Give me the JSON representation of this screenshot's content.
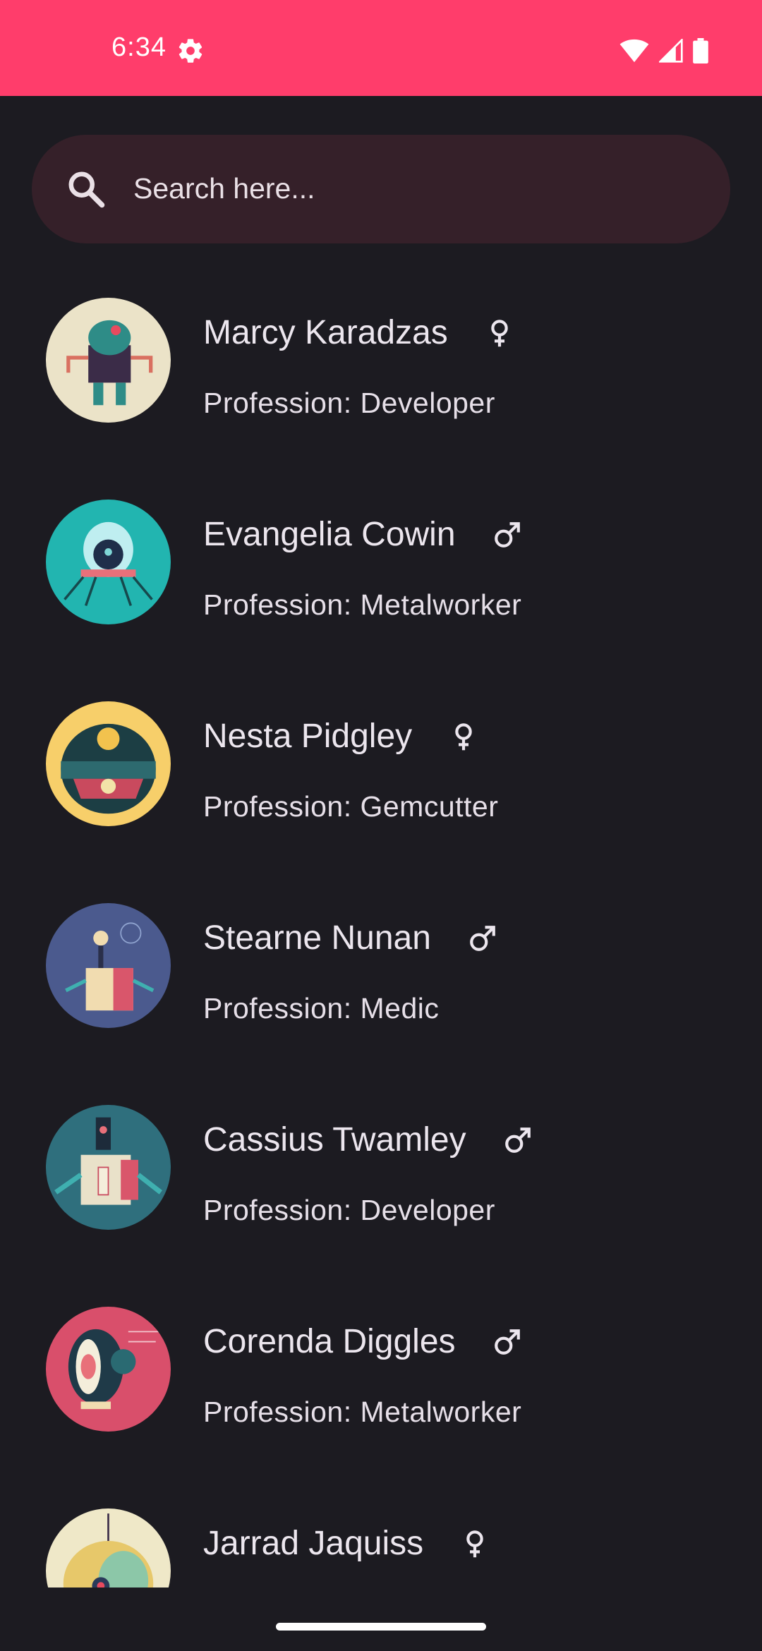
{
  "status_bar": {
    "time": "6:34",
    "background_color": "#ff3d6b",
    "icons": [
      "settings-gear-icon",
      "wifi-icon",
      "cellular-signal-icon",
      "battery-icon"
    ]
  },
  "search": {
    "placeholder": "Search here...",
    "icon": "search-icon"
  },
  "characters": [
    {
      "name": "Marcy Karadzas",
      "gender": "female",
      "profession": "Profession: Developer",
      "avatar_color": "#ebe3c8"
    },
    {
      "name": "Evangelia Cowin",
      "gender": "male",
      "profession": "Profession: Metalworker",
      "avatar_color": "#22b5b0"
    },
    {
      "name": "Nesta Pidgley",
      "gender": "female",
      "profession": "Profession: Gemcutter",
      "avatar_color": "#f7cf6a"
    },
    {
      "name": "Stearne Nunan",
      "gender": "male",
      "profession": "Profession: Medic",
      "avatar_color": "#4b5a8e"
    },
    {
      "name": "Cassius Twamley",
      "gender": "male",
      "profession": "Profession: Developer",
      "avatar_color": "#2f6f7d"
    },
    {
      "name": "Corenda Diggles",
      "gender": "male",
      "profession": "Profession: Metalworker",
      "avatar_color": "#d94f6b"
    },
    {
      "name": "Jarrad Jaquiss",
      "gender": "female",
      "profession": "",
      "avatar_color": "#efe8c8"
    }
  ]
}
